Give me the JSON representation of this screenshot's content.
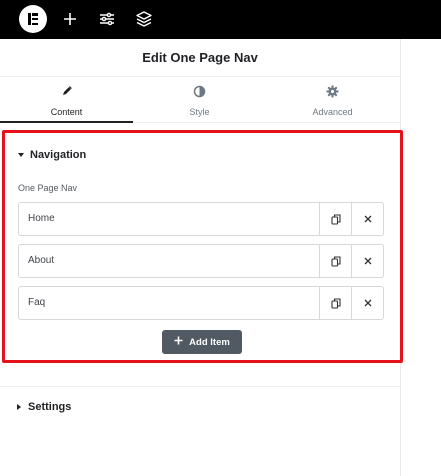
{
  "toolbar": {
    "logo_icon": "elementor-logo-icon",
    "add_icon": "plus-icon",
    "settings_icon": "sliders-icon",
    "structure_icon": "layers-icon"
  },
  "panel": {
    "title": "Edit One Page Nav",
    "tabs": [
      {
        "label": "Content",
        "icon": "pencil-icon",
        "active": true
      },
      {
        "label": "Style",
        "icon": "half-circle-icon",
        "active": false
      },
      {
        "label": "Advanced",
        "icon": "gear-icon",
        "active": false
      }
    ]
  },
  "navigation": {
    "heading": "Navigation",
    "field_label": "One Page Nav",
    "items": [
      {
        "title": "Home"
      },
      {
        "title": "About"
      },
      {
        "title": "Faq"
      }
    ],
    "add_label": "Add Item"
  },
  "settings": {
    "heading": "Settings"
  },
  "colors": {
    "highlight": "#e5121a",
    "add_button": "#515962",
    "topbar": "#000000"
  }
}
